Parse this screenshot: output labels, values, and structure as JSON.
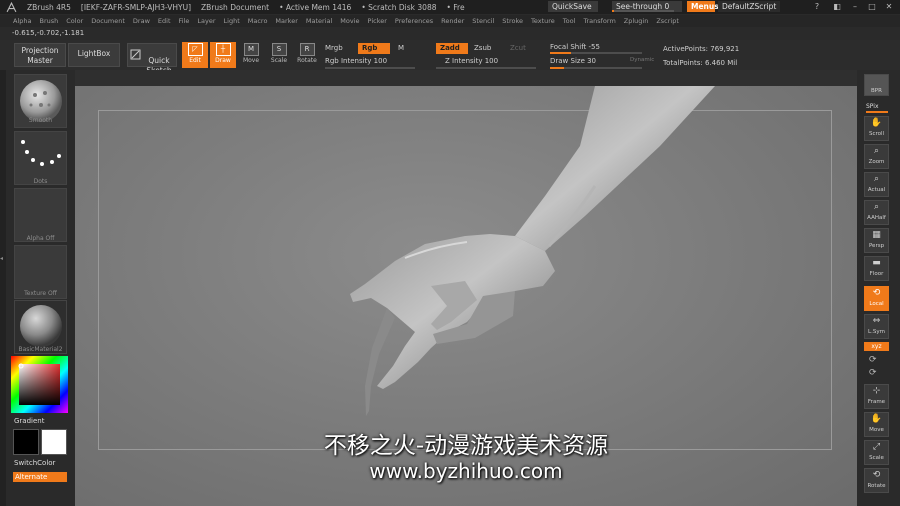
{
  "titlebar": {
    "app": "ZBrush 4R5",
    "serial": "[IEKF-ZAFR-SMLP-AJH3-VHYU]",
    "document": "ZBrush Document",
    "active_mem": "• Active Mem 1416",
    "scratch_disk": "• Scratch Disk 3088",
    "free": "• Fre",
    "quicksave": "QuickSave",
    "see_through": "See-through  0",
    "menus": "Menus",
    "default_zscript": "DefaultZScript",
    "colors": {
      "accent": "#f07a1a",
      "bg": "#1f1f1f"
    }
  },
  "menubar": {
    "items": [
      "Alpha",
      "Brush",
      "Color",
      "Document",
      "Draw",
      "Edit",
      "File",
      "Layer",
      "Light",
      "Macro",
      "Marker",
      "Material",
      "Movie",
      "Picker",
      "Preferences",
      "Render",
      "Stencil",
      "Stroke",
      "Texture",
      "Tool",
      "Transform",
      "Zplugin",
      "Zscript"
    ]
  },
  "coords": "-0.615,-0.702,-1.181",
  "toolbar": {
    "projection_master": "Projection\nMaster",
    "lightbox": "LightBox",
    "quick_sketch": "Quick\nSketch",
    "edit": "Edit",
    "draw": "Draw",
    "move": "Move",
    "scale": "Scale",
    "rotate": "Rotate",
    "mrgb": "Mrgb",
    "rgb": "Rgb",
    "m": "M",
    "rgb_intensity": "Rgb  Intensity 100",
    "zadd": "Zadd",
    "zsub": "Zsub",
    "zcut": "Zcut",
    "z_intensity": "Z  Intensity 100",
    "focal_shift": "Focal  Shift -55",
    "draw_size": "Draw  Size 30",
    "dynamic": "Dynamic",
    "active_points": "ActivePoints: 769,921",
    "total_points": "TotalPoints: 6.460  Mil",
    "rgb_intensity_value": 100,
    "z_intensity_value": 100,
    "focal_shift_value": -55,
    "draw_size_value": 30
  },
  "leftpanel": {
    "brush": "Smooth",
    "stroke": "Dots",
    "alpha": "Alpha  Off",
    "texture": "Texture  Off",
    "material": "BasicMaterial2",
    "gradient": "Gradient",
    "switchcolor": "SwitchColor",
    "alternate": "Alternate"
  },
  "rightpanel": {
    "bpr": "BPR",
    "spix": "SPix",
    "scroll": "Scroll",
    "zoom": "Zoom",
    "actual": "Actual",
    "aahalf": "AAHalf",
    "persp": "Persp",
    "floor": "Floor",
    "local": "Local",
    "lsym": "L.Sym",
    "xyz": "xyz",
    "frame": "Frame",
    "move": "Move",
    "scale": "Scale",
    "rotate": "Rotate"
  },
  "watermark": {
    "line1": "不移之火-动漫游戏美术资源",
    "line2": "www.byzhihuo.com"
  }
}
